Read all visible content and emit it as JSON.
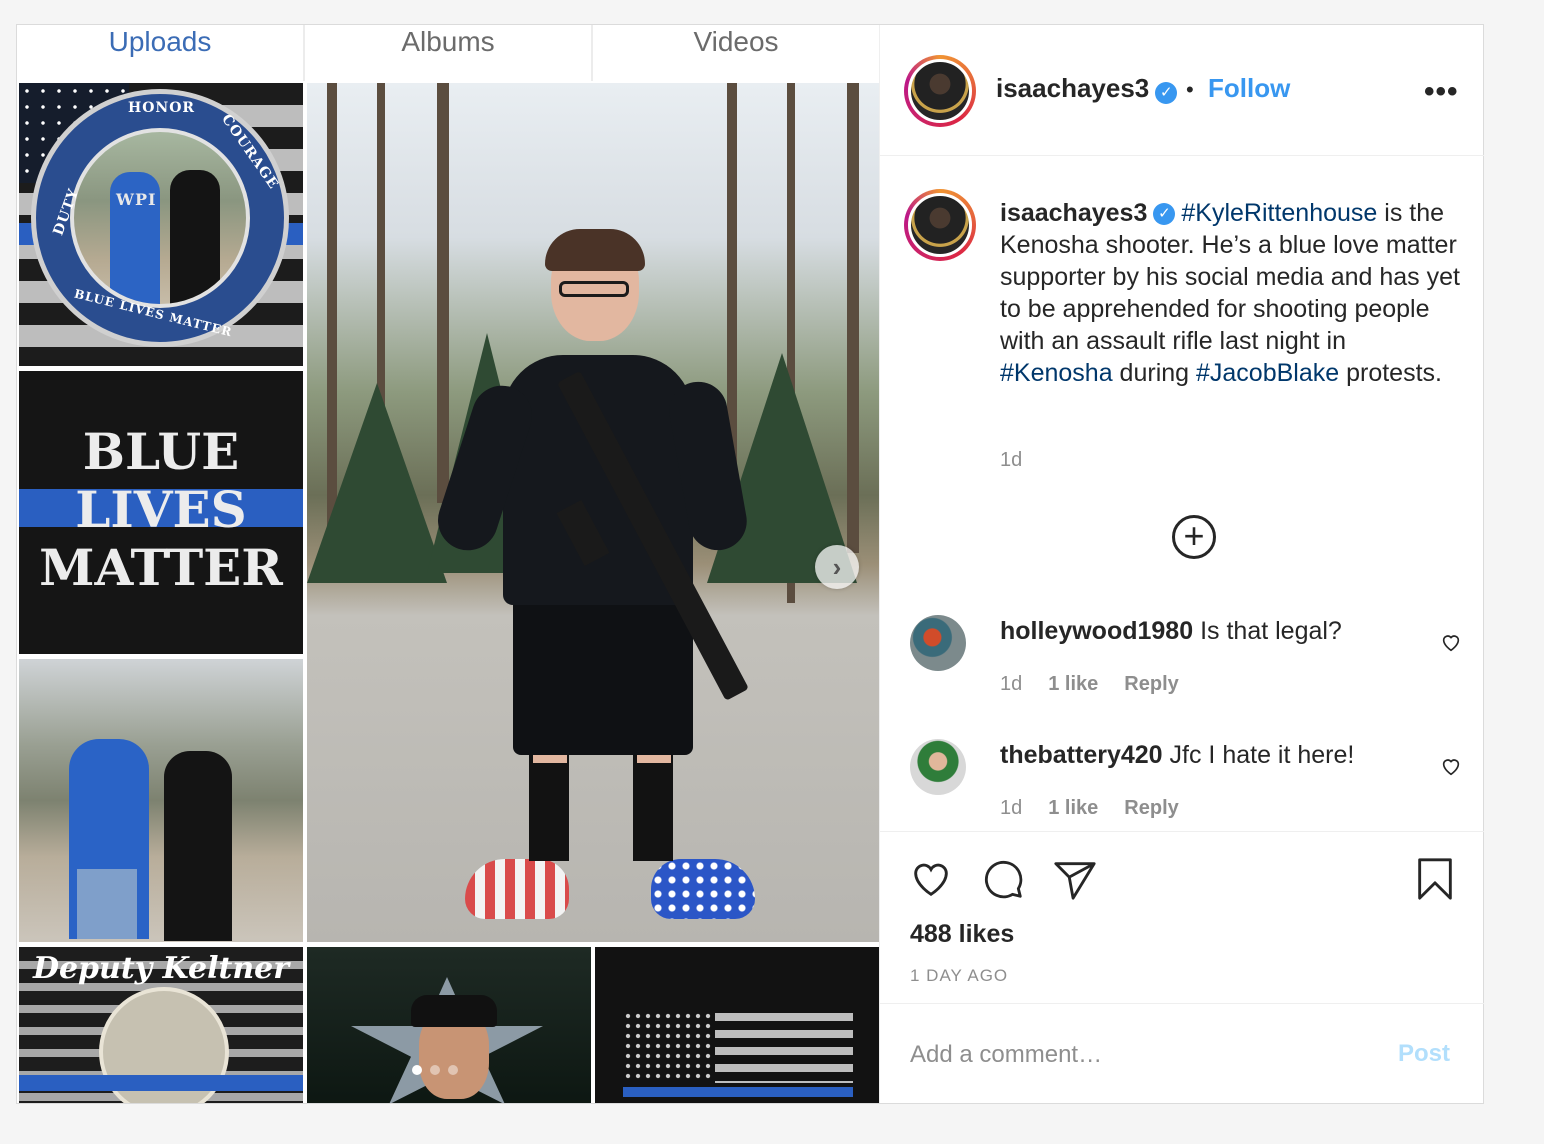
{
  "tabs": [
    {
      "label": "Uploads",
      "active": true
    },
    {
      "label": "Albums",
      "active": false
    },
    {
      "label": "Videos",
      "active": false
    }
  ],
  "media": {
    "blm_text": [
      "BLUE",
      "LIVES",
      "MATTER"
    ],
    "badge_text": {
      "top": "HONOR",
      "left": "DUTY",
      "right": "COURAGE",
      "bottom": "BLUE LIVES MATTER",
      "center": "WPI"
    },
    "deputy_text": "Deputy Keltner",
    "next_icon": "chevron-right-icon",
    "carousel_dots": 3,
    "carousel_active": 1
  },
  "header": {
    "username": "isaachayes3",
    "verified": true,
    "separator": "•",
    "follow_label": "Follow",
    "more_label": "•••"
  },
  "caption": {
    "username": "isaachayes3",
    "hashtag1": "#KyleRittenhouse",
    "text1": " is the Kenosha shooter. He’s a blue love matter supporter by his social media and has yet to be apprehended for shooting people with an assault rifle last night in ",
    "hashtag2": "#Kenosha",
    "text2": " during ",
    "hashtag3": "#JacobBlake",
    "text3": " protests.",
    "time": "1d"
  },
  "load_more_icon": "plus-circle-icon",
  "comments": [
    {
      "username": "holleywood1980",
      "text": "Is that legal?",
      "time": "1d",
      "likes": "1 like",
      "reply": "Reply"
    },
    {
      "username": "thebattery420",
      "text": "Jfc I hate it here!",
      "time": "1d",
      "likes": "1 like",
      "reply": "Reply"
    }
  ],
  "actions": {
    "likes": "488 likes",
    "time": "1 DAY AGO",
    "icons": [
      "heart-icon",
      "comment-icon",
      "share-icon",
      "bookmark-icon"
    ]
  },
  "add_comment": {
    "placeholder": "Add a comment…",
    "post_label": "Post"
  },
  "colors": {
    "link": "#3897f0",
    "hashtag": "#00376b",
    "muted": "#8e8e8e",
    "post_disabled": "#b2dffc",
    "tab_active": "#3b6cb5"
  }
}
